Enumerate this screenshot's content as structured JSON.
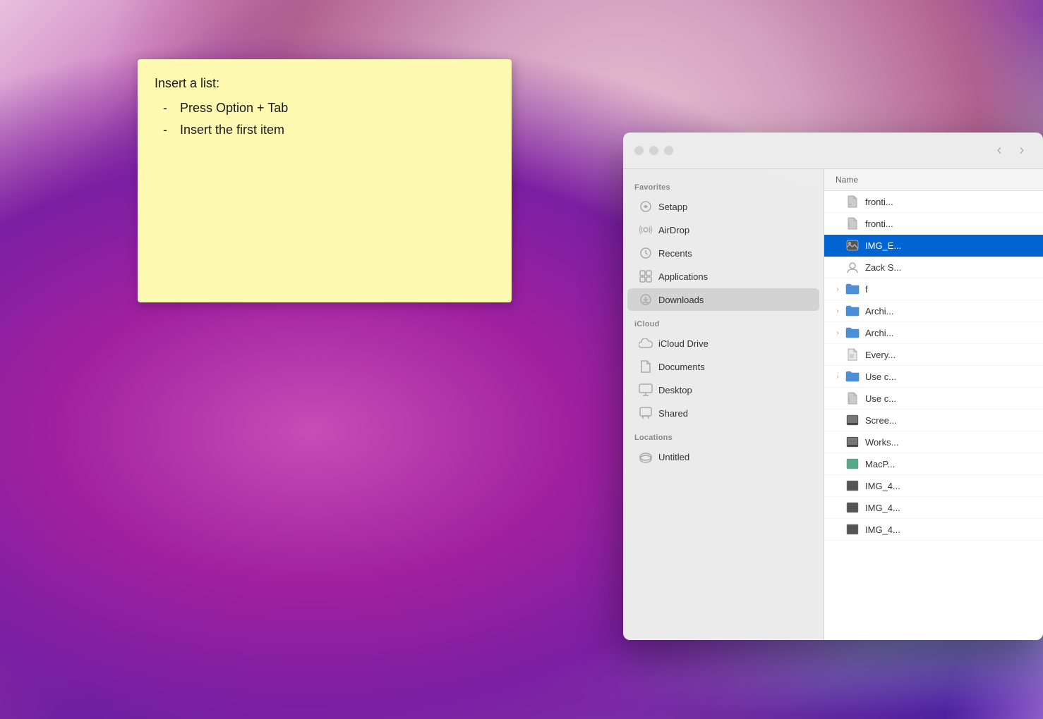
{
  "wallpaper": {
    "description": "macOS Big Sur gradient wallpaper"
  },
  "sticky_note": {
    "title": "Insert a list:",
    "items": [
      {
        "dash": "-",
        "text": "Press Option + Tab"
      },
      {
        "dash": "-",
        "text": "Insert the first item"
      }
    ]
  },
  "finder": {
    "window_controls": {
      "close": "●",
      "minimize": "●",
      "maximize": "●"
    },
    "nav": {
      "back": "‹",
      "forward": "›"
    },
    "sidebar": {
      "sections": [
        {
          "label": "Favorites",
          "items": [
            {
              "id": "setapp",
              "icon": "setapp",
              "label": "Setapp"
            },
            {
              "id": "airdrop",
              "icon": "airdrop",
              "label": "AirDrop"
            },
            {
              "id": "recents",
              "icon": "recents",
              "label": "Recents"
            },
            {
              "id": "applications",
              "icon": "applications",
              "label": "Applications"
            },
            {
              "id": "downloads",
              "icon": "downloads",
              "label": "Downloads",
              "active": true
            }
          ]
        },
        {
          "label": "iCloud",
          "items": [
            {
              "id": "icloud-drive",
              "icon": "cloud",
              "label": "iCloud Drive"
            },
            {
              "id": "documents",
              "icon": "documents",
              "label": "Documents"
            },
            {
              "id": "desktop",
              "icon": "desktop",
              "label": "Desktop"
            },
            {
              "id": "shared",
              "icon": "shared",
              "label": "Shared"
            }
          ]
        },
        {
          "label": "Locations",
          "items": [
            {
              "id": "untitled",
              "icon": "disk",
              "label": "Untitled"
            }
          ]
        }
      ]
    },
    "content": {
      "column_header": "Name",
      "files": [
        {
          "id": 1,
          "name": "fronti...",
          "icon": "file",
          "expandable": false,
          "selected": false
        },
        {
          "id": 2,
          "name": "fronti...",
          "icon": "file",
          "expandable": false,
          "selected": false
        },
        {
          "id": 3,
          "name": "IMG_E...",
          "icon": "image",
          "expandable": false,
          "selected": true
        },
        {
          "id": 4,
          "name": "Zack S...",
          "icon": "contact",
          "expandable": false,
          "selected": false
        },
        {
          "id": 5,
          "name": "f",
          "icon": "folder",
          "expandable": true,
          "selected": false
        },
        {
          "id": 6,
          "name": "Archi...",
          "icon": "folder",
          "expandable": true,
          "selected": false
        },
        {
          "id": 7,
          "name": "Archi...",
          "icon": "folder",
          "expandable": true,
          "selected": false
        },
        {
          "id": 8,
          "name": "Every...",
          "icon": "zip",
          "expandable": false,
          "selected": false
        },
        {
          "id": 9,
          "name": "Use c...",
          "icon": "folder",
          "expandable": true,
          "selected": false
        },
        {
          "id": 10,
          "name": "Use c...",
          "icon": "file",
          "expandable": false,
          "selected": false
        },
        {
          "id": 11,
          "name": "Scree...",
          "icon": "image",
          "expandable": false,
          "selected": false
        },
        {
          "id": 12,
          "name": "Works...",
          "icon": "image",
          "expandable": false,
          "selected": false
        },
        {
          "id": 13,
          "name": "MacP...",
          "icon": "image",
          "expandable": false,
          "selected": false
        },
        {
          "id": 14,
          "name": "IMG_4...",
          "icon": "image",
          "expandable": false,
          "selected": false
        },
        {
          "id": 15,
          "name": "IMG_4...",
          "icon": "image",
          "expandable": false,
          "selected": false
        },
        {
          "id": 16,
          "name": "IMG_4...",
          "icon": "image",
          "expandable": false,
          "selected": false
        }
      ]
    }
  }
}
